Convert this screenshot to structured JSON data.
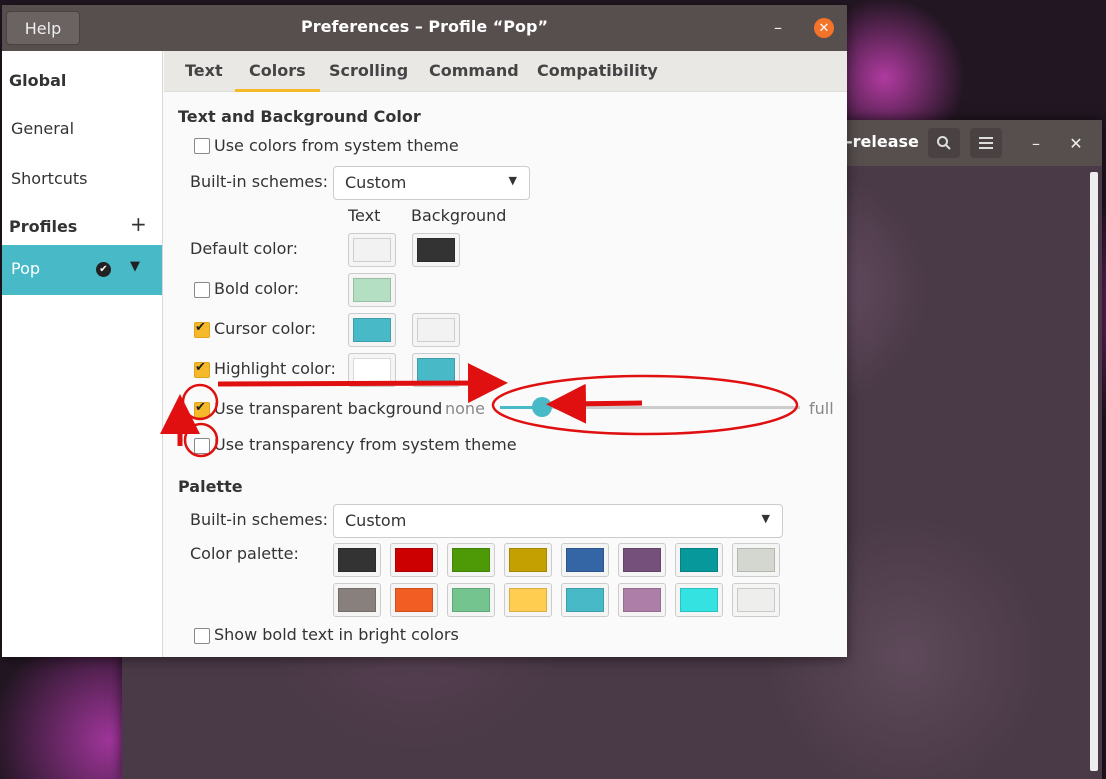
{
  "terminal": {
    "title": "-release",
    "search_icon": "search-icon",
    "menu_icon": "hamburger-menu-icon",
    "min_label": "–",
    "close_label": "✕"
  },
  "dialog": {
    "help_label": "Help",
    "title": "Preferences – Profile “Pop”",
    "min_label": "–",
    "close_label": "✕"
  },
  "sidebar": {
    "global_heading": "Global",
    "general": "General",
    "shortcuts": "Shortcuts",
    "profiles_heading": "Profiles",
    "add_label": "+",
    "selected_profile": "Pop",
    "selected_arrow": "▼"
  },
  "tabs": [
    "Text",
    "Colors",
    "Scrolling",
    "Command",
    "Compatibility"
  ],
  "text_bg": {
    "section": "Text and Background Color",
    "use_system": "Use colors from system theme",
    "builtin_label": "Built-in schemes:",
    "builtin_value": "Custom",
    "col_text": "Text",
    "col_background": "Background",
    "default_color": "Default color:",
    "bold_color": "Bold color:",
    "cursor_color": "Cursor color:",
    "highlight_color": "Highlight color:",
    "transparent_bg": "Use transparent background",
    "none": "none",
    "full": "full",
    "transparency_system": "Use transparency from system theme",
    "transparency_level": 0.14
  },
  "palette": {
    "section": "Palette",
    "builtin_label": "Built-in schemes:",
    "builtin_value": "Custom",
    "color_palette": "Color palette:",
    "bright_bold": "Show bold text in bright colors",
    "row1": [
      "#333333",
      "#cc0000",
      "#4e9a06",
      "#c4a000",
      "#3465a4",
      "#75507b",
      "#06989a",
      "#d3d7cf"
    ],
    "row2": [
      "#88807c",
      "#f15d22",
      "#73c48f",
      "#ffce51",
      "#48b9c7",
      "#ad7fa8",
      "#34e2e2",
      "#eeeeec"
    ]
  },
  "colors": {
    "accent": "#48b9c7",
    "check": "#f6b92b",
    "annotation": "#e01010"
  }
}
